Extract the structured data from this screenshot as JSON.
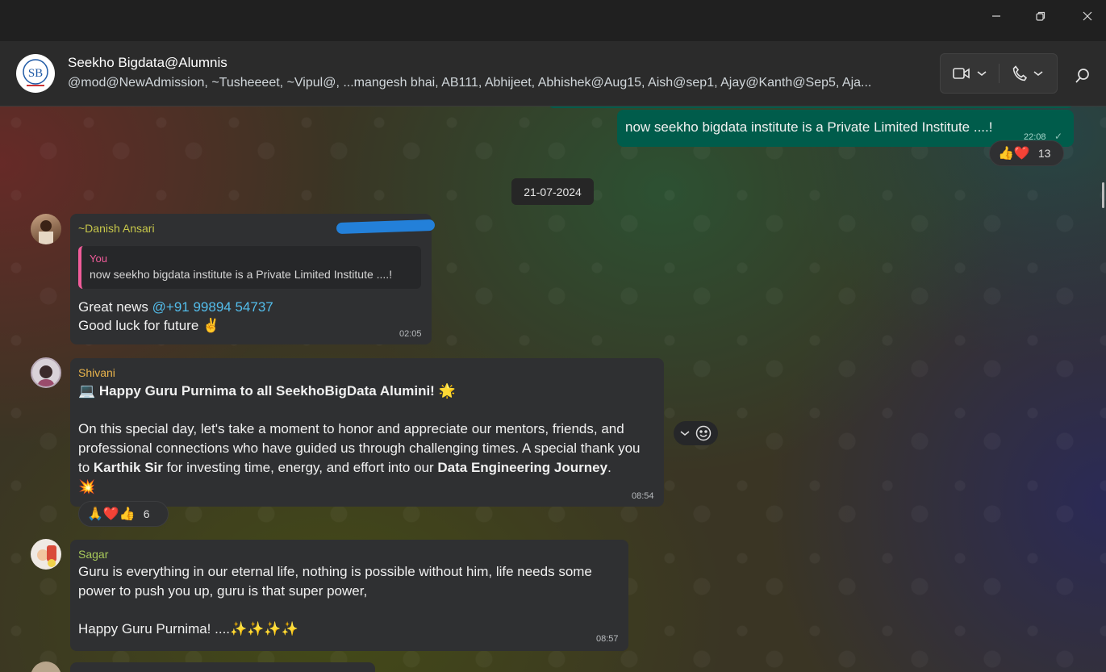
{
  "window": {
    "controls": {
      "minimize": "minimize-icon",
      "maximize": "restore-icon",
      "close": "close-icon"
    }
  },
  "header": {
    "avatar_text": "SB",
    "title": "Seekho Bigdata@Alumnis",
    "members": "@mod@NewAdmission, ~Tusheeeet, ~Vipul@, ...mangesh bhai, AB111, Abhijeet, Abhishek@Aug15, Aish@sep1, Ajay@Kanth@Sep5, Aja..."
  },
  "messages": {
    "outgoing": {
      "text": "now seekho bigdata institute is a Private Limited Institute ....!",
      "time": "22:08",
      "status": "✓",
      "reactions": {
        "emojis": "👍❤️",
        "count": "13"
      }
    },
    "date_chip": "21-07-2024",
    "danish": {
      "sender": "~Danish Ansari",
      "quote_author": "You",
      "quote_text": "now seekho bigdata institute is a Private Limited Institute ....!",
      "line1_prefix": "Great news ",
      "mention": "@+91 99894 54737",
      "line2": "Good luck for future ✌️",
      "time": "02:05"
    },
    "shivani": {
      "sender": "Shivani",
      "heading_emoji": "💻",
      "heading": "Happy Guru Purnima to all SeekhoBigData Alumini!",
      "heading_end": " 🌟",
      "p1": "On this special day, let's take a moment to honor and appreciate our mentors, friends, and professional connections who have guided us through challenging times. A special thank you to ",
      "bold1": "Karthik Sir",
      "p2": " for investing time, energy, and effort into our ",
      "bold2": "Data Engineering Journey",
      "p3": ".",
      "end_emoji": "💥",
      "time": "08:54",
      "reactions": {
        "emojis": "🙏❤️👍",
        "count": "6"
      }
    },
    "sagar": {
      "sender": "Sagar",
      "text1": "Guru is everything in our eternal life, nothing is possible without him, life needs some power to push you up, guru is that super power,",
      "text2": "Happy Guru Purnima! ....✨✨✨✨",
      "time": "08:57"
    }
  },
  "colors": {
    "outgoing_bubble": "#005c4b",
    "danish_name": "#c6c64a",
    "shivani_name": "#e9b44c",
    "sagar_name": "#a8c95a",
    "quote_accent": "#f15c9a"
  }
}
